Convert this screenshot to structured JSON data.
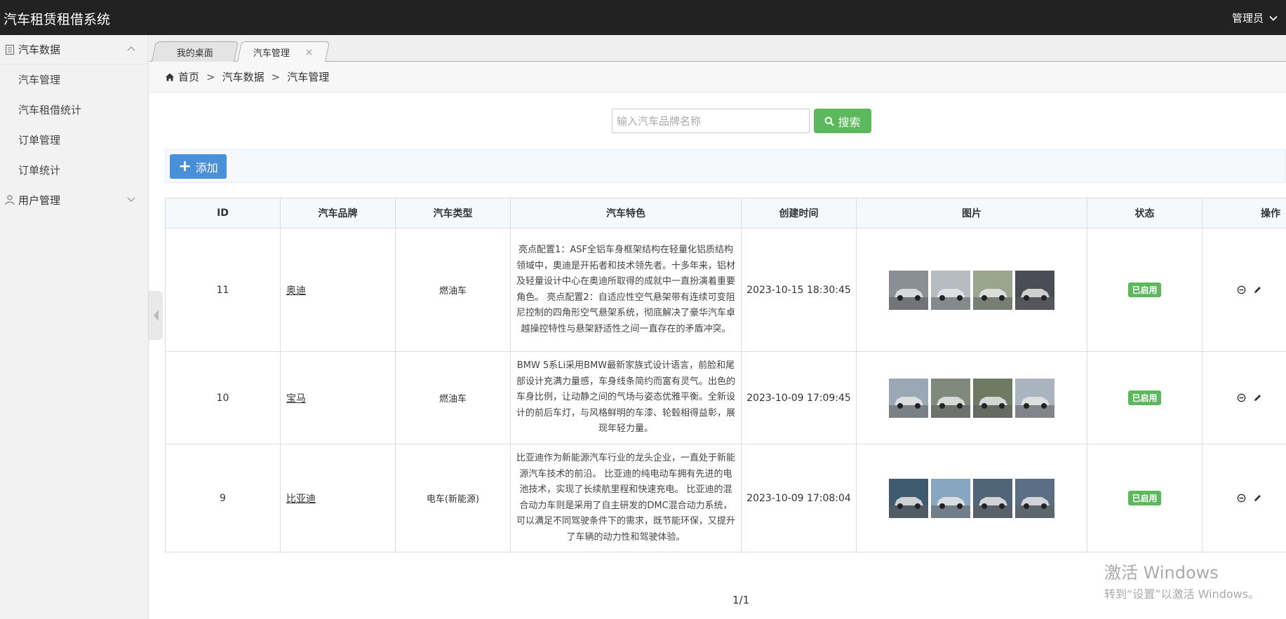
{
  "header": {
    "title": "汽车租赁租借系统",
    "user": "管理员"
  },
  "sidebar": {
    "groups": [
      {
        "label": "汽车数据",
        "items": [
          "汽车管理",
          "汽车租借统计",
          "订单管理",
          "订单统计"
        ]
      },
      {
        "label": "用户管理",
        "items": []
      }
    ]
  },
  "tabs": [
    {
      "label": "我的桌面"
    },
    {
      "label": "汽车管理",
      "close": "×"
    }
  ],
  "breadcrumb": [
    "首页",
    "汽车数据",
    "汽车管理"
  ],
  "search": {
    "placeholder": "输入汽车品牌名称",
    "button": "搜索"
  },
  "toolbar": {
    "add_label": "添加",
    "add_symbol": "+"
  },
  "table": {
    "headers": [
      "ID",
      "汽车品牌",
      "汽车类型",
      "汽车特色",
      "创建时间",
      "图片",
      "状态",
      "操作"
    ],
    "rows": [
      {
        "id": "11",
        "brand": "奥迪",
        "type": "燃油车",
        "feature": "亮点配置1：ASF全铝车身框架结构在轻量化铝质结构领域中，奥迪是开拓者和技术领先者。十多年来，铝材及轻量设计中心在奥迪所取得的成就中一直扮演着重要角色。 亮点配置2：自适应性空气悬架带有连续可变阻尼控制的四角形空气悬架系统，彻底解决了豪华汽车卓越操控特性与悬架舒适性之间一直存在的矛盾冲突。",
        "created": "2023-10-15 18:30:45",
        "status": "已启用",
        "thumb_colors": [
          "#8a8f96",
          "#b7bcc2",
          "#9aa58e",
          "#4a4d55"
        ]
      },
      {
        "id": "10",
        "brand": "宝马",
        "type": "燃油车",
        "feature": "BMW 5系Li采用BMW最新家族式设计语言，前脸和尾部设计充满力量感，车身线条简约而富有灵气。出色的车身比例，让动静之间的气场与姿态优雅平衡。全新设计的前后车灯，与风格鲜明的车漆、轮毂相得益彰，展现年轻力量。",
        "created": "2023-10-09 17:09:45",
        "status": "已启用",
        "thumb_colors": [
          "#9aa8b6",
          "#7f8a7c",
          "#6e7a63",
          "#aab4c0"
        ]
      },
      {
        "id": "9",
        "brand": "比亚迪",
        "type": "电车(新能源)",
        "feature": "比亚迪作为新能源汽车行业的龙头企业，一直处于新能源汽车技术的前沿。 比亚迪的纯电动车拥有先进的电池技术，实现了长续航里程和快速充电。 比亚迪的混合动力车则是采用了自主研发的DMC混合动力系统，可以满足不同驾驶条件下的需求，既节能环保，又提升了车辆的动力性和驾驶体验。",
        "created": "2023-10-09 17:08:04",
        "status": "已启用",
        "thumb_colors": [
          "#3e5a6e",
          "#88a6c0",
          "#506478",
          "#5b6e84"
        ]
      }
    ]
  },
  "pager": "1/1",
  "watermark": {
    "line1": "激活 Windows",
    "line2": "转到“设置”以激活 Windows。"
  }
}
